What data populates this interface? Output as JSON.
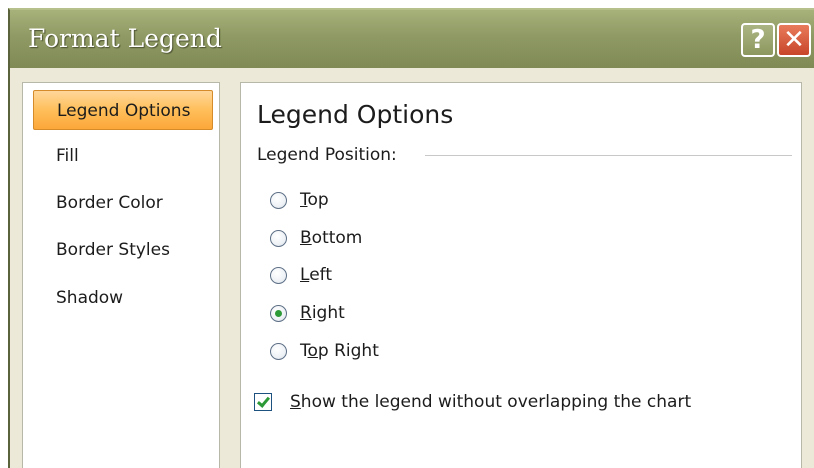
{
  "window": {
    "title": "Format Legend",
    "help_label": "?",
    "close_label": "✕"
  },
  "nav": {
    "items": [
      {
        "label": "Legend Options",
        "selected": true
      },
      {
        "label": "Fill"
      },
      {
        "label": "Border Color"
      },
      {
        "label": "Border Styles"
      },
      {
        "label": "Shadow"
      }
    ]
  },
  "content": {
    "section_title": "Legend Options",
    "position_group_label": "Legend Position:",
    "positions": [
      {
        "mnemonic": "T",
        "rest": "op",
        "checked": false
      },
      {
        "mnemonic": "B",
        "rest": "ottom",
        "checked": false
      },
      {
        "mnemonic": "L",
        "rest": "eft",
        "checked": false
      },
      {
        "mnemonic": "R",
        "rest": "ight",
        "checked": true
      },
      {
        "pre": "T",
        "mnemonic": "o",
        "rest": "p Right",
        "checked": false
      }
    ],
    "no_overlap": {
      "mnemonic": "S",
      "rest": "how the legend without overlapping the chart",
      "checked": true
    }
  },
  "colors": {
    "selected_nav_fill": "#ffbf5a",
    "check_mark": "#2d9a38",
    "close_button": "#c8452a"
  }
}
